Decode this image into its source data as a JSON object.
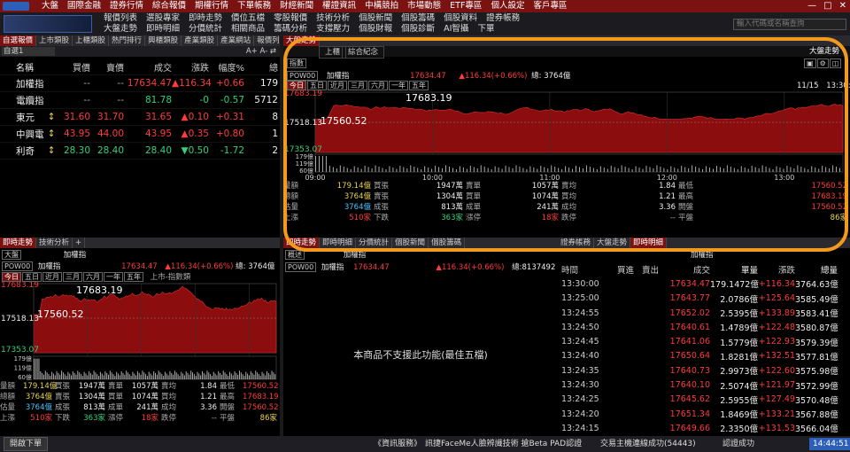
{
  "menu": {
    "items": [
      "大盤",
      "國際金融",
      "證券行情",
      "綜合報價",
      "期權行情",
      "下單帳務",
      "財經新聞",
      "權證資訊",
      "中構競拍",
      "市場動態",
      "ETF專區",
      "個人設定",
      "客戶專區"
    ],
    "window_controls": [
      "—",
      "□",
      "✕"
    ]
  },
  "toolbar": {
    "row1": [
      "報價列表",
      "選股專家",
      "即時走勢",
      "價位五檔",
      "零股報價",
      "技術分析",
      "個股新聞",
      "個股籌碼",
      "個股資料",
      "證券帳務"
    ],
    "row2": [
      "大盤走勢",
      "即時明細",
      "分價統計",
      "相關商品",
      "籌碼分析",
      "支撐壓力",
      "個股財報",
      "個股診斷",
      "AI智攝",
      "下單"
    ],
    "search_placeholder": "輸入代碼或名稱查詢"
  },
  "list_panel": {
    "tabs": [
      "自選報價",
      "上市類股",
      "上櫃類股",
      "熱門排行",
      "興櫃類股",
      "產業類股",
      "產業網站",
      "報價列表"
    ],
    "group_name": "自選1",
    "ops": "A+ A- ⇄",
    "columns": [
      "名稱",
      "",
      "買價",
      "賣價",
      "成交",
      "漲跌",
      "幅度%",
      "總"
    ],
    "rows": [
      {
        "name": "加權指",
        "flag": "",
        "bid": "--",
        "ask": "--",
        "last": "17634.47",
        "chg": "▲116.34",
        "pct": "+0.66",
        "vol": "179"
      },
      {
        "name": "電纜指",
        "flag": "",
        "bid": "--",
        "ask": "--",
        "last": "81.78",
        "chg": "-0",
        "pct": "-0.57",
        "vol": "5712"
      },
      {
        "name": "東元",
        "flag": "↕",
        "bid": "31.60",
        "ask": "31.70",
        "last": "31.65",
        "chg": "▲0.10",
        "pct": "+0.31",
        "vol": "8"
      },
      {
        "name": "中興電",
        "flag": "↕",
        "bid": "43.95",
        "ask": "44.00",
        "last": "43.95",
        "chg": "▲0.35",
        "pct": "+0.80",
        "vol": "1"
      },
      {
        "name": "利奇",
        "flag": "↕",
        "bid": "28.30",
        "ask": "28.40",
        "last": "28.40",
        "chg": "▼0.50",
        "pct": "-1.72",
        "vol": "2"
      }
    ]
  },
  "chart_panel": {
    "tab": "大盤走勢",
    "sub_tabs": [
      "上櫃",
      "綜合紀念"
    ],
    "title_right": "大盤走勢",
    "code": "POW00",
    "name": "加權指",
    "price": "17634.47",
    "change": "▲116.34(+0.66%)",
    "volume_label": "總: 3764億",
    "periods": [
      "今日",
      "五日",
      "近月",
      "三月",
      "六月",
      "一年",
      "五年"
    ],
    "date": "11/15",
    "time": "13:30:00",
    "price_ticks": [
      "17683.19",
      "17518.13",
      "17353.07"
    ],
    "vol_ticks": [
      "179億",
      "119億",
      "60億"
    ],
    "time_ticks": [
      "09:00",
      "10:00",
      "11:00",
      "12:00",
      "13:00"
    ],
    "annotations": [
      "17683.19",
      "17560.52"
    ],
    "tag": "指數"
  },
  "stats_rows": [
    [
      "量額",
      "179.14億",
      "買張",
      "1947萬",
      "賣單",
      "1057萬",
      "賣均",
      "1.84",
      "最低",
      "17560.52"
    ],
    [
      "總額",
      "3764億",
      "賣張",
      "1304萬",
      "買單",
      "1074萬",
      "買均",
      "1.21",
      "最高",
      "17683.19"
    ],
    [
      "估量",
      "3764億",
      "成張",
      "813萬",
      "成單",
      "241萬",
      "成均",
      "3.36",
      "開盤",
      "17560.52"
    ],
    [
      "上漲",
      "510家",
      "下跌",
      "363家",
      "漲停",
      "18家",
      "跌停",
      "--",
      "平盤",
      "86家"
    ]
  ],
  "lower_left": {
    "tabs": [
      "即時走勢",
      "技術分析"
    ],
    "sub": [
      "加權指",
      "大盤"
    ],
    "code": "POW00",
    "name": "加權指",
    "price": "17634.47",
    "change": "▲116.34(+0.66%)",
    "volume_label": "總: 3764億",
    "periods": [
      "今日",
      "五日",
      "近月",
      "三月",
      "六月",
      "一年",
      "五年"
    ],
    "period_note": "上市-指數類",
    "price_ticks": [
      "17683.19",
      "17518.13",
      "17353.07"
    ],
    "annotations": [
      "17683.19",
      "17560.52"
    ],
    "vol_ticks": [
      "179億",
      "119億",
      "60億"
    ]
  },
  "lower_mid": {
    "tabs": [
      "即時走勢",
      "即時明細",
      "分價統計",
      "個股新聞",
      "個股籌碼"
    ],
    "sub": [
      "加權指"
    ],
    "code": "POW00",
    "name": "加權指",
    "price": "17634.47",
    "change": "▲116.34(+0.66%)",
    "volume_label": "總:8137492",
    "message": "本商品不支援此功能(最佳五檔)"
  },
  "lower_right": {
    "tabs": [
      "證券帳務",
      "大盤走勢",
      "即時明細"
    ],
    "sub": "加權指",
    "columns": [
      "時間",
      "買進",
      "賣出",
      "成交",
      "單量",
      "漲跌",
      "總量"
    ],
    "rows": [
      [
        "13:30:00",
        "",
        "",
        "17634.47",
        "179.1472億",
        "+116.34",
        "3764.63億"
      ],
      [
        "13:25:00",
        "",
        "",
        "17643.77",
        "2.0786億",
        "+125.64",
        "3585.49億"
      ],
      [
        "13:24:55",
        "",
        "",
        "17652.02",
        "2.5395億",
        "+133.89",
        "3583.41億"
      ],
      [
        "13:24:50",
        "",
        "",
        "17640.61",
        "1.4789億",
        "+122.48",
        "3580.87億"
      ],
      [
        "13:24:45",
        "",
        "",
        "17641.06",
        "1.5779億",
        "+122.93",
        "3579.39億"
      ],
      [
        "13:24:40",
        "",
        "",
        "17650.64",
        "1.8281億",
        "+132.51",
        "3577.81億"
      ],
      [
        "13:24:35",
        "",
        "",
        "17640.73",
        "2.9973億",
        "+122.60",
        "3575.98億"
      ],
      [
        "13:24:30",
        "",
        "",
        "17640.10",
        "2.5074億",
        "+121.97",
        "3572.99億"
      ],
      [
        "13:24:25",
        "",
        "",
        "17645.62",
        "2.5955億",
        "+127.49",
        "3570.48億"
      ],
      [
        "13:24:20",
        "",
        "",
        "17651.34",
        "1.8469億",
        "+133.21",
        "3567.88億"
      ],
      [
        "13:24:15",
        "",
        "",
        "17649.66",
        "2.3350億",
        "+131.53",
        "3566.04億"
      ],
      [
        "13:24:10",
        "",
        "",
        "17640.08",
        "2.8032億",
        "+122.05",
        "3563.70億"
      ]
    ]
  },
  "statusbar": {
    "left_button": "開啟下單",
    "news": "《資訊服務》",
    "marquee": "訊捷FaceMe人臉辨識技術 搶Beta PAD認證",
    "connection": "交易主機連線成功(54443)",
    "login": "認證成功",
    "clock": "14:44:51"
  },
  "colors": {
    "up": "#ff3b3b",
    "down": "#33d17a",
    "menu": "#7a1212",
    "highlight": "#f39a1e"
  }
}
